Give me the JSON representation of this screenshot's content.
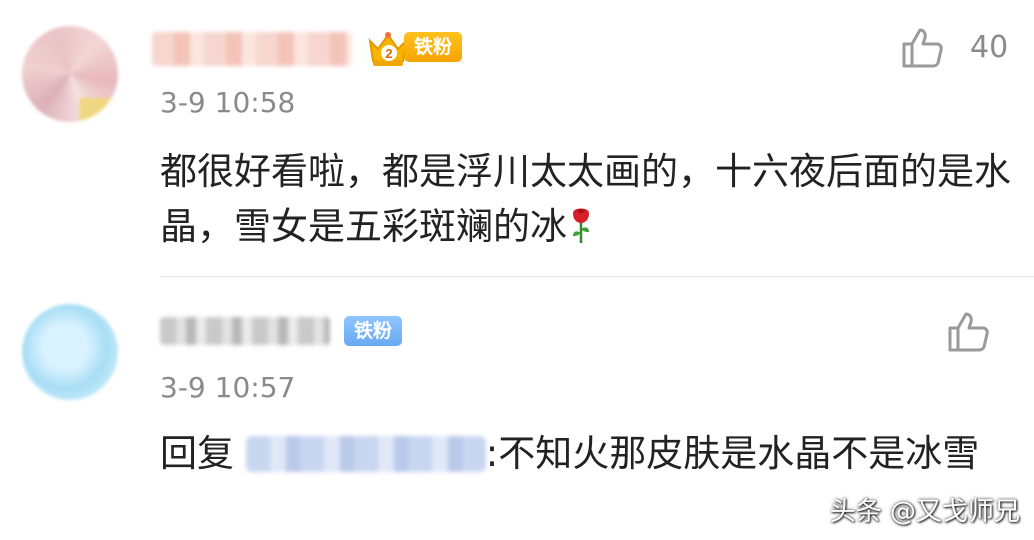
{
  "comments": [
    {
      "username": "",
      "badge": "铁粉",
      "vip_level": "2",
      "time": "3-9  10:58",
      "likes": "40",
      "text": "都很好看啦，都是浮川太太画的，十六夜后面的是水晶，雪女是五彩斑斓的冰",
      "emoji_icon": "rose-emoji-icon"
    },
    {
      "username": "",
      "badge": "铁粉",
      "time": "3-9  10:57",
      "reply_prefix": "回复 ",
      "text": ":不知火那皮肤是水晶不是冰雪"
    }
  ],
  "watermark": "头条 @又戈师兄",
  "colors": {
    "gold_badge": "#f6a400",
    "blue_badge": "#67a9f3",
    "text": "#222222",
    "meta": "#8a8a8a"
  }
}
